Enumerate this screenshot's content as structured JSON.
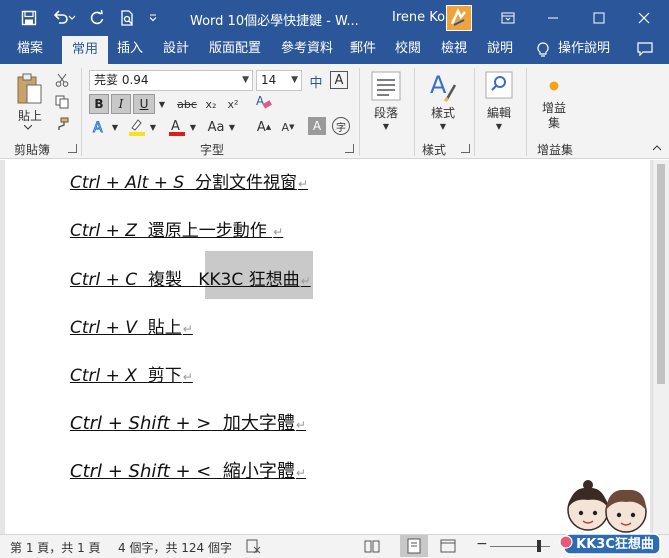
{
  "titlebar": {
    "title": "Word 10個必學快捷鍵 - W...",
    "user": "Irene Ko",
    "icons": [
      "save-icon",
      "undo-icon",
      "redo-icon",
      "print-preview-icon",
      "customize-qat-icon",
      "ribbon-display-icon",
      "minimize-icon",
      "maximize-icon",
      "close-icon"
    ]
  },
  "tabs": [
    {
      "label": "檔案"
    },
    {
      "label": "常用",
      "active": true
    },
    {
      "label": "插入"
    },
    {
      "label": "設計"
    },
    {
      "label": "版面配置"
    },
    {
      "label": "參考資料"
    },
    {
      "label": "郵件"
    },
    {
      "label": "校閱"
    },
    {
      "label": "檢視"
    },
    {
      "label": "說明"
    },
    {
      "label": "操作說明"
    }
  ],
  "ribbon": {
    "clipboard": {
      "label": "剪貼簿",
      "paste": "貼上"
    },
    "font": {
      "label": "字型",
      "font_name": "芫荽 0.94",
      "font_size": "14",
      "bold": "B",
      "italic": "I",
      "underline": "U",
      "strike": "abc",
      "subscript": "x₂",
      "superscript": "x²",
      "grow": "A",
      "shrink": "A",
      "phonetic": "中",
      "border_char": "A",
      "char_shading": "A",
      "enclose": "字"
    },
    "paragraph": {
      "label": "段落"
    },
    "styles": {
      "label": "樣式",
      "button": "樣式"
    },
    "editing": {
      "label": "編輯"
    },
    "addins": {
      "label": "增益集",
      "button": "增益集"
    }
  },
  "document": {
    "lines": [
      {
        "keys": "Ctrl + Alt + S",
        "desc": "分割文件視窗"
      },
      {
        "keys": "Ctrl + Z",
        "desc": "還原上一步動作"
      },
      {
        "keys": "Ctrl + C",
        "desc": "複製",
        "extra": "KK3C 狂想曲"
      },
      {
        "keys": "Ctrl + V",
        "desc": "貼上"
      },
      {
        "keys": "Ctrl + X",
        "desc": "剪下"
      },
      {
        "keys": "Ctrl + Shift + >",
        "desc": "加大字體"
      },
      {
        "keys": "Ctrl + Shift + <",
        "desc": "縮小字體"
      }
    ],
    "paragraph_mark": "↵"
  },
  "status": {
    "page": "第 1 頁，共 1 頁",
    "words": "4 個字，共 124 個字"
  },
  "watermark": {
    "text": "KK3C狂想曲"
  }
}
